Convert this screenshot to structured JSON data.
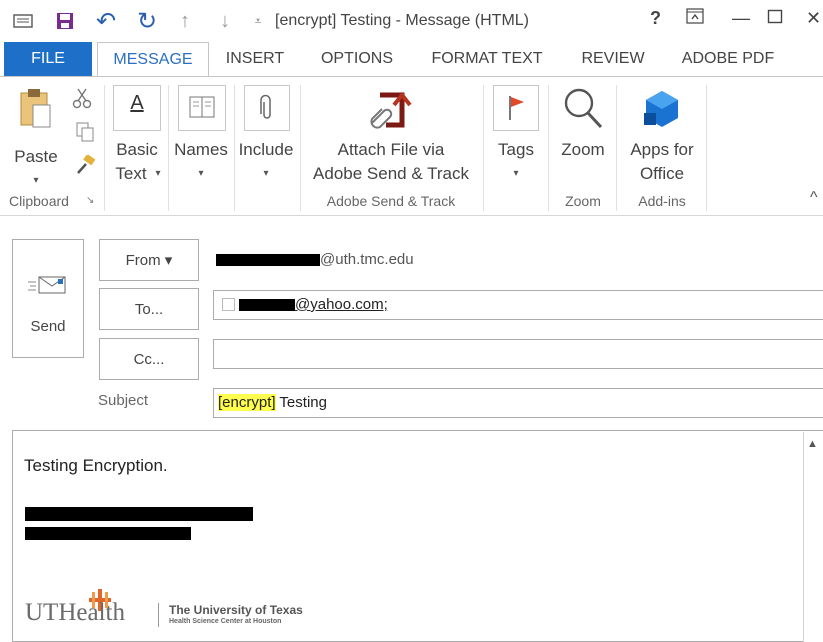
{
  "window": {
    "title": "[encrypt] Testing - Message (HTML)",
    "help_glyph": "?",
    "restore_glyph": "⧉",
    "minimize_glyph": "—",
    "maximize_glyph": "☐",
    "close_glyph": "✕"
  },
  "qat": {
    "undo_glyph": "↶",
    "redo_glyph": "↻",
    "up_glyph": "↑",
    "down_glyph": "↓",
    "customize_glyph": "⩡"
  },
  "tabs": [
    "FILE",
    "MESSAGE",
    "INSERT",
    "OPTIONS",
    "FORMAT TEXT",
    "REVIEW",
    "ADOBE PDF"
  ],
  "ribbon": {
    "paste": "Paste",
    "basic_text_1": "Basic",
    "basic_text_2": "Text",
    "names": "Names",
    "include": "Include",
    "attach_1": "Attach File via",
    "attach_2": "Adobe Send & Track",
    "tags": "Tags",
    "zoom": "Zoom",
    "apps_1": "Apps for",
    "apps_2": "Office",
    "caret": "▾",
    "collapse_glyph": "^",
    "groups": {
      "clipboard": "Clipboard",
      "adobe": "Adobe Send & Track",
      "zoom": "Zoom",
      "addins": "Add-ins"
    }
  },
  "compose": {
    "send": "Send",
    "from_btn": "From ▾",
    "to_btn": "To...",
    "cc_btn": "Cc...",
    "subject_label": "Subject",
    "from_suffix": "@uth.tmc.edu",
    "to_suffix": "@yahoo.com;",
    "subject_tag": "[encrypt]",
    "subject_rest": " Testing"
  },
  "body": {
    "line1": "Testing Encryption.",
    "logo_text": "UTHealth",
    "univ_line1": "The University of Texas",
    "univ_line2": "Health Science Center at Houston",
    "scroll_up": "▲"
  }
}
